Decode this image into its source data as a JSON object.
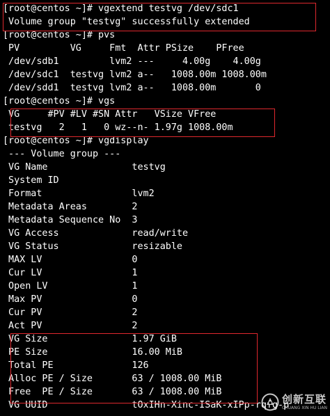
{
  "terminal": {
    "lines": [
      "[root@centos ~]# vgextend testvg /dev/sdc1",
      " Volume group \"testvg\" successfully extended",
      "[root@centos ~]# pvs",
      " PV         VG     Fmt  Attr PSize    PFree",
      " /dev/sdb1         lvm2 ---     4.00g    4.00g",
      " /dev/sdc1  testvg lvm2 a--   1008.00m 1008.00m",
      " /dev/sdd1  testvg lvm2 a--   1008.00m       0",
      "[root@centos ~]# vgs",
      " VG     #PV #LV #SN Attr   VSize VFree",
      " testvg   2   1   0 wz--n- 1.97g 1008.00m",
      "[root@centos ~]# vgdisplay",
      " --- Volume group ---",
      " VG Name               testvg",
      " System ID",
      " Format                lvm2",
      " Metadata Areas        2",
      " Metadata Sequence No  3",
      " VG Access             read/write",
      " VG Status             resizable",
      " MAX LV                0",
      " Cur LV                1",
      " Open LV               1",
      " Max PV                0",
      " Cur PV                2",
      " Act PV                2",
      " VG Size               1.97 GiB",
      " PE Size               16.00 MiB",
      " Total PE              126",
      " Alloc PE / Size       63 / 1008.00 MiB",
      " Free  PE / Size       63 / 1008.00 MiB",
      " VG UUID               tOxIHn-Xinc-ISaK-xIPp-rqfg-p"
    ]
  },
  "watermark": {
    "brand_cn": "创新互联",
    "brand_en": "CHUANG XIN HU LIAN"
  },
  "colors": {
    "background": "#000000",
    "text": "#ffffff",
    "highlight_box": "#e0282e"
  }
}
